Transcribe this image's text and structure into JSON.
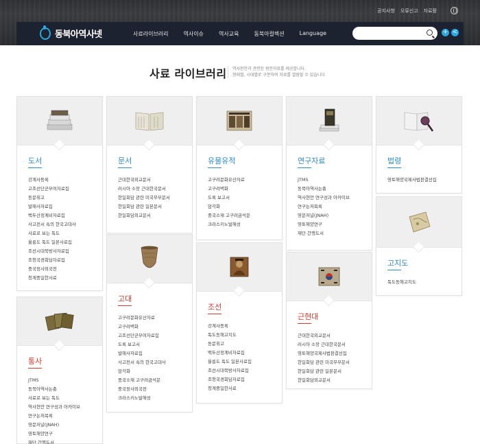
{
  "utility": {
    "notice": "공지사항",
    "report": "오류신고",
    "materials": "자료활"
  },
  "logo": {
    "text": "동북아역사넷"
  },
  "menu": [
    "사료라이브러리",
    "역사이슈",
    "역사교육",
    "동북아컬렉션",
    "Language"
  ],
  "search": {
    "placeholder": ""
  },
  "page": {
    "title": "사료 라이브러리",
    "desc1": "역사현안과 관련된 원문자료를 제공합니다.",
    "desc2": "형태별, 시대별로 구분하여 자료를 열람할 수 있습니다"
  },
  "cards": {
    "books": {
      "title": "도서",
      "icon": "book-stack-icon",
      "items": [
        "강계사등록",
        "고조선단군부여자료집",
        "동문휘고",
        "발해사자료집",
        "백두산정계비자료집",
        "사고전서 속의 한국고대사",
        "사료로 보는 독도",
        "울릉도 독도 일본사료집",
        "조선시대북방사자료집",
        "조청국경회담자료집",
        "중국정사외국전",
        "청계중일한사료"
      ]
    },
    "docs": {
      "title": "문서",
      "icon": "open-document-icon",
      "items": [
        "근대한국외교문서",
        "러시아 소장 근대한국문서",
        "한일회담 관련 미국무부문서",
        "한일회담 관련 일본문서",
        "한일회담외교문서"
      ]
    },
    "relics": {
      "title": "유물유적",
      "icon": "relic-book-icon",
      "items": [
        "고구려문화유산자료",
        "고구려벽화",
        "도록 보고서",
        "암각화",
        "중국소재 고구려금석문",
        "크라스키노발해성"
      ]
    },
    "research": {
      "title": "연구자료",
      "icon": "research-books-icon",
      "items": [
        "JTMS",
        "동북아역사논총",
        "역사현안 연구성과 아카이브",
        "연구논저목록",
        "영문저널(JNAH)",
        "영토해양연구",
        "재단 간행도서"
      ]
    },
    "law": {
      "title": "법령",
      "icon": "law-magnifier-icon",
      "items": [
        "영토해양국제사법판결선집"
      ]
    },
    "oldmap": {
      "title": "고지도",
      "icon": "old-map-icon",
      "items": [
        "독도동해고지도"
      ]
    },
    "ancient": {
      "title": "고대",
      "icon": "pottery-icon",
      "items": [
        "고구려문화유산자료",
        "고구려벽화",
        "고조선단군부여자료집",
        "도록 보고서",
        "발해사자료집",
        "사고전서 속의 한국고대사",
        "암각화",
        "중국소재 고구려금석문",
        "중국정사외국전",
        "크라스키노발해성"
      ]
    },
    "joseon": {
      "title": "조선",
      "icon": "portrait-icon",
      "items": [
        "강계사등록",
        "독도동해고지도",
        "동문휘고",
        "백두산정계비자료집",
        "울릉도 독도 일본사료집",
        "조선시대북방사자료집",
        "조청국경회담자료집",
        "청계중일한사료"
      ]
    },
    "modern": {
      "title": "근현대",
      "icon": "flag-icon",
      "items": [
        "근대한국외교문서",
        "러시아 소장 근대한국문서",
        "영토해양국제사법판결선집",
        "한일회담 관련 미국무부문서",
        "한일회담 관련 일본문서",
        "한일회담외교문서"
      ]
    },
    "general": {
      "title": "통사",
      "icon": "cards-icon",
      "items": [
        "JTMS",
        "동북아역사논총",
        "사료로 보는 독도",
        "역사현안 연구성과 아카이브",
        "연구논저목록",
        "영문저널(JNAH)",
        "영토해양연구",
        "재단 간행도서"
      ]
    }
  }
}
